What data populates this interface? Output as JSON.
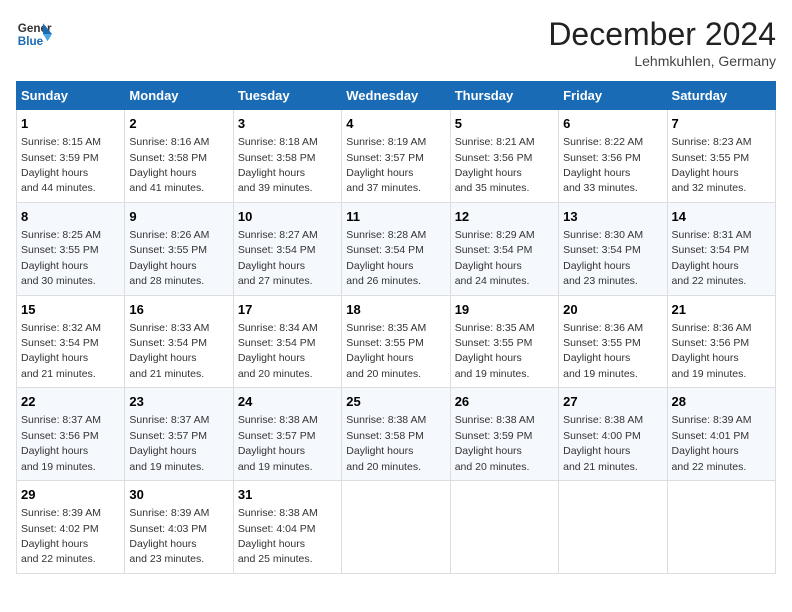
{
  "header": {
    "logo_line1": "General",
    "logo_line2": "Blue",
    "month": "December 2024",
    "location": "Lehmkuhlen, Germany"
  },
  "weekdays": [
    "Sunday",
    "Monday",
    "Tuesday",
    "Wednesday",
    "Thursday",
    "Friday",
    "Saturday"
  ],
  "weeks": [
    [
      {
        "day": "1",
        "sunrise": "8:15 AM",
        "sunset": "3:59 PM",
        "daylight": "7 hours and 44 minutes."
      },
      {
        "day": "2",
        "sunrise": "8:16 AM",
        "sunset": "3:58 PM",
        "daylight": "7 hours and 41 minutes."
      },
      {
        "day": "3",
        "sunrise": "8:18 AM",
        "sunset": "3:58 PM",
        "daylight": "7 hours and 39 minutes."
      },
      {
        "day": "4",
        "sunrise": "8:19 AM",
        "sunset": "3:57 PM",
        "daylight": "7 hours and 37 minutes."
      },
      {
        "day": "5",
        "sunrise": "8:21 AM",
        "sunset": "3:56 PM",
        "daylight": "7 hours and 35 minutes."
      },
      {
        "day": "6",
        "sunrise": "8:22 AM",
        "sunset": "3:56 PM",
        "daylight": "7 hours and 33 minutes."
      },
      {
        "day": "7",
        "sunrise": "8:23 AM",
        "sunset": "3:55 PM",
        "daylight": "7 hours and 32 minutes."
      }
    ],
    [
      {
        "day": "8",
        "sunrise": "8:25 AM",
        "sunset": "3:55 PM",
        "daylight": "7 hours and 30 minutes."
      },
      {
        "day": "9",
        "sunrise": "8:26 AM",
        "sunset": "3:55 PM",
        "daylight": "7 hours and 28 minutes."
      },
      {
        "day": "10",
        "sunrise": "8:27 AM",
        "sunset": "3:54 PM",
        "daylight": "7 hours and 27 minutes."
      },
      {
        "day": "11",
        "sunrise": "8:28 AM",
        "sunset": "3:54 PM",
        "daylight": "7 hours and 26 minutes."
      },
      {
        "day": "12",
        "sunrise": "8:29 AM",
        "sunset": "3:54 PM",
        "daylight": "7 hours and 24 minutes."
      },
      {
        "day": "13",
        "sunrise": "8:30 AM",
        "sunset": "3:54 PM",
        "daylight": "7 hours and 23 minutes."
      },
      {
        "day": "14",
        "sunrise": "8:31 AM",
        "sunset": "3:54 PM",
        "daylight": "7 hours and 22 minutes."
      }
    ],
    [
      {
        "day": "15",
        "sunrise": "8:32 AM",
        "sunset": "3:54 PM",
        "daylight": "7 hours and 21 minutes."
      },
      {
        "day": "16",
        "sunrise": "8:33 AM",
        "sunset": "3:54 PM",
        "daylight": "7 hours and 21 minutes."
      },
      {
        "day": "17",
        "sunrise": "8:34 AM",
        "sunset": "3:54 PM",
        "daylight": "7 hours and 20 minutes."
      },
      {
        "day": "18",
        "sunrise": "8:35 AM",
        "sunset": "3:55 PM",
        "daylight": "7 hours and 20 minutes."
      },
      {
        "day": "19",
        "sunrise": "8:35 AM",
        "sunset": "3:55 PM",
        "daylight": "7 hours and 19 minutes."
      },
      {
        "day": "20",
        "sunrise": "8:36 AM",
        "sunset": "3:55 PM",
        "daylight": "7 hours and 19 minutes."
      },
      {
        "day": "21",
        "sunrise": "8:36 AM",
        "sunset": "3:56 PM",
        "daylight": "7 hours and 19 minutes."
      }
    ],
    [
      {
        "day": "22",
        "sunrise": "8:37 AM",
        "sunset": "3:56 PM",
        "daylight": "7 hours and 19 minutes."
      },
      {
        "day": "23",
        "sunrise": "8:37 AM",
        "sunset": "3:57 PM",
        "daylight": "7 hours and 19 minutes."
      },
      {
        "day": "24",
        "sunrise": "8:38 AM",
        "sunset": "3:57 PM",
        "daylight": "7 hours and 19 minutes."
      },
      {
        "day": "25",
        "sunrise": "8:38 AM",
        "sunset": "3:58 PM",
        "daylight": "7 hours and 20 minutes."
      },
      {
        "day": "26",
        "sunrise": "8:38 AM",
        "sunset": "3:59 PM",
        "daylight": "7 hours and 20 minutes."
      },
      {
        "day": "27",
        "sunrise": "8:38 AM",
        "sunset": "4:00 PM",
        "daylight": "7 hours and 21 minutes."
      },
      {
        "day": "28",
        "sunrise": "8:39 AM",
        "sunset": "4:01 PM",
        "daylight": "7 hours and 22 minutes."
      }
    ],
    [
      {
        "day": "29",
        "sunrise": "8:39 AM",
        "sunset": "4:02 PM",
        "daylight": "7 hours and 22 minutes."
      },
      {
        "day": "30",
        "sunrise": "8:39 AM",
        "sunset": "4:03 PM",
        "daylight": "7 hours and 23 minutes."
      },
      {
        "day": "31",
        "sunrise": "8:38 AM",
        "sunset": "4:04 PM",
        "daylight": "7 hours and 25 minutes."
      },
      null,
      null,
      null,
      null
    ]
  ]
}
